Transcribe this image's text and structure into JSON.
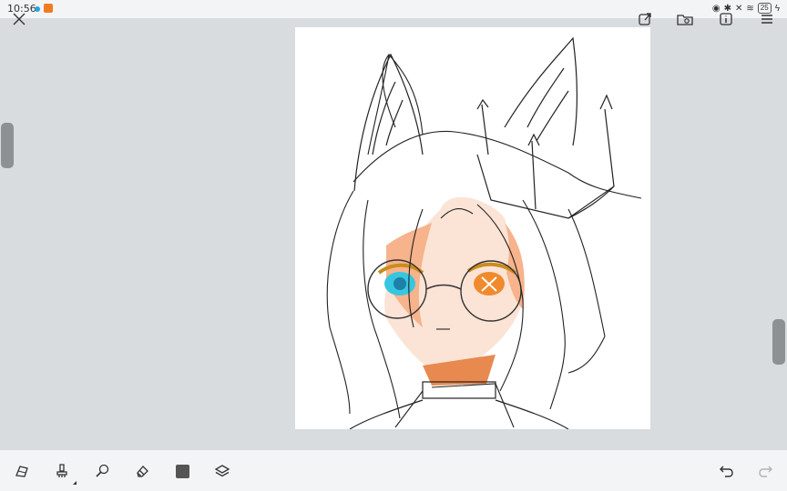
{
  "status_bar": {
    "time": "10:56",
    "battery": "25"
  },
  "top_toolbar": {
    "icons": [
      "close-icon",
      "export-icon",
      "gallery-icon",
      "info-icon",
      "more-icon"
    ]
  },
  "canvas": {
    "colors": {
      "background": "#d9dcde",
      "paper": "#ffffff",
      "skin": "#f6b38c",
      "skin_light": "#fbe3d5",
      "eye_left": "#36c6e0",
      "eye_right": "#f08a2c",
      "glasses_frame": "#d7a23a"
    }
  },
  "bottom_toolbar": {
    "tools": [
      "selection-tool-icon",
      "brush-tool-icon",
      "smudge-tool-icon",
      "eraser-tool-icon",
      "color-swatch",
      "layers-icon"
    ],
    "actions": [
      "undo-icon",
      "redo-icon"
    ]
  }
}
